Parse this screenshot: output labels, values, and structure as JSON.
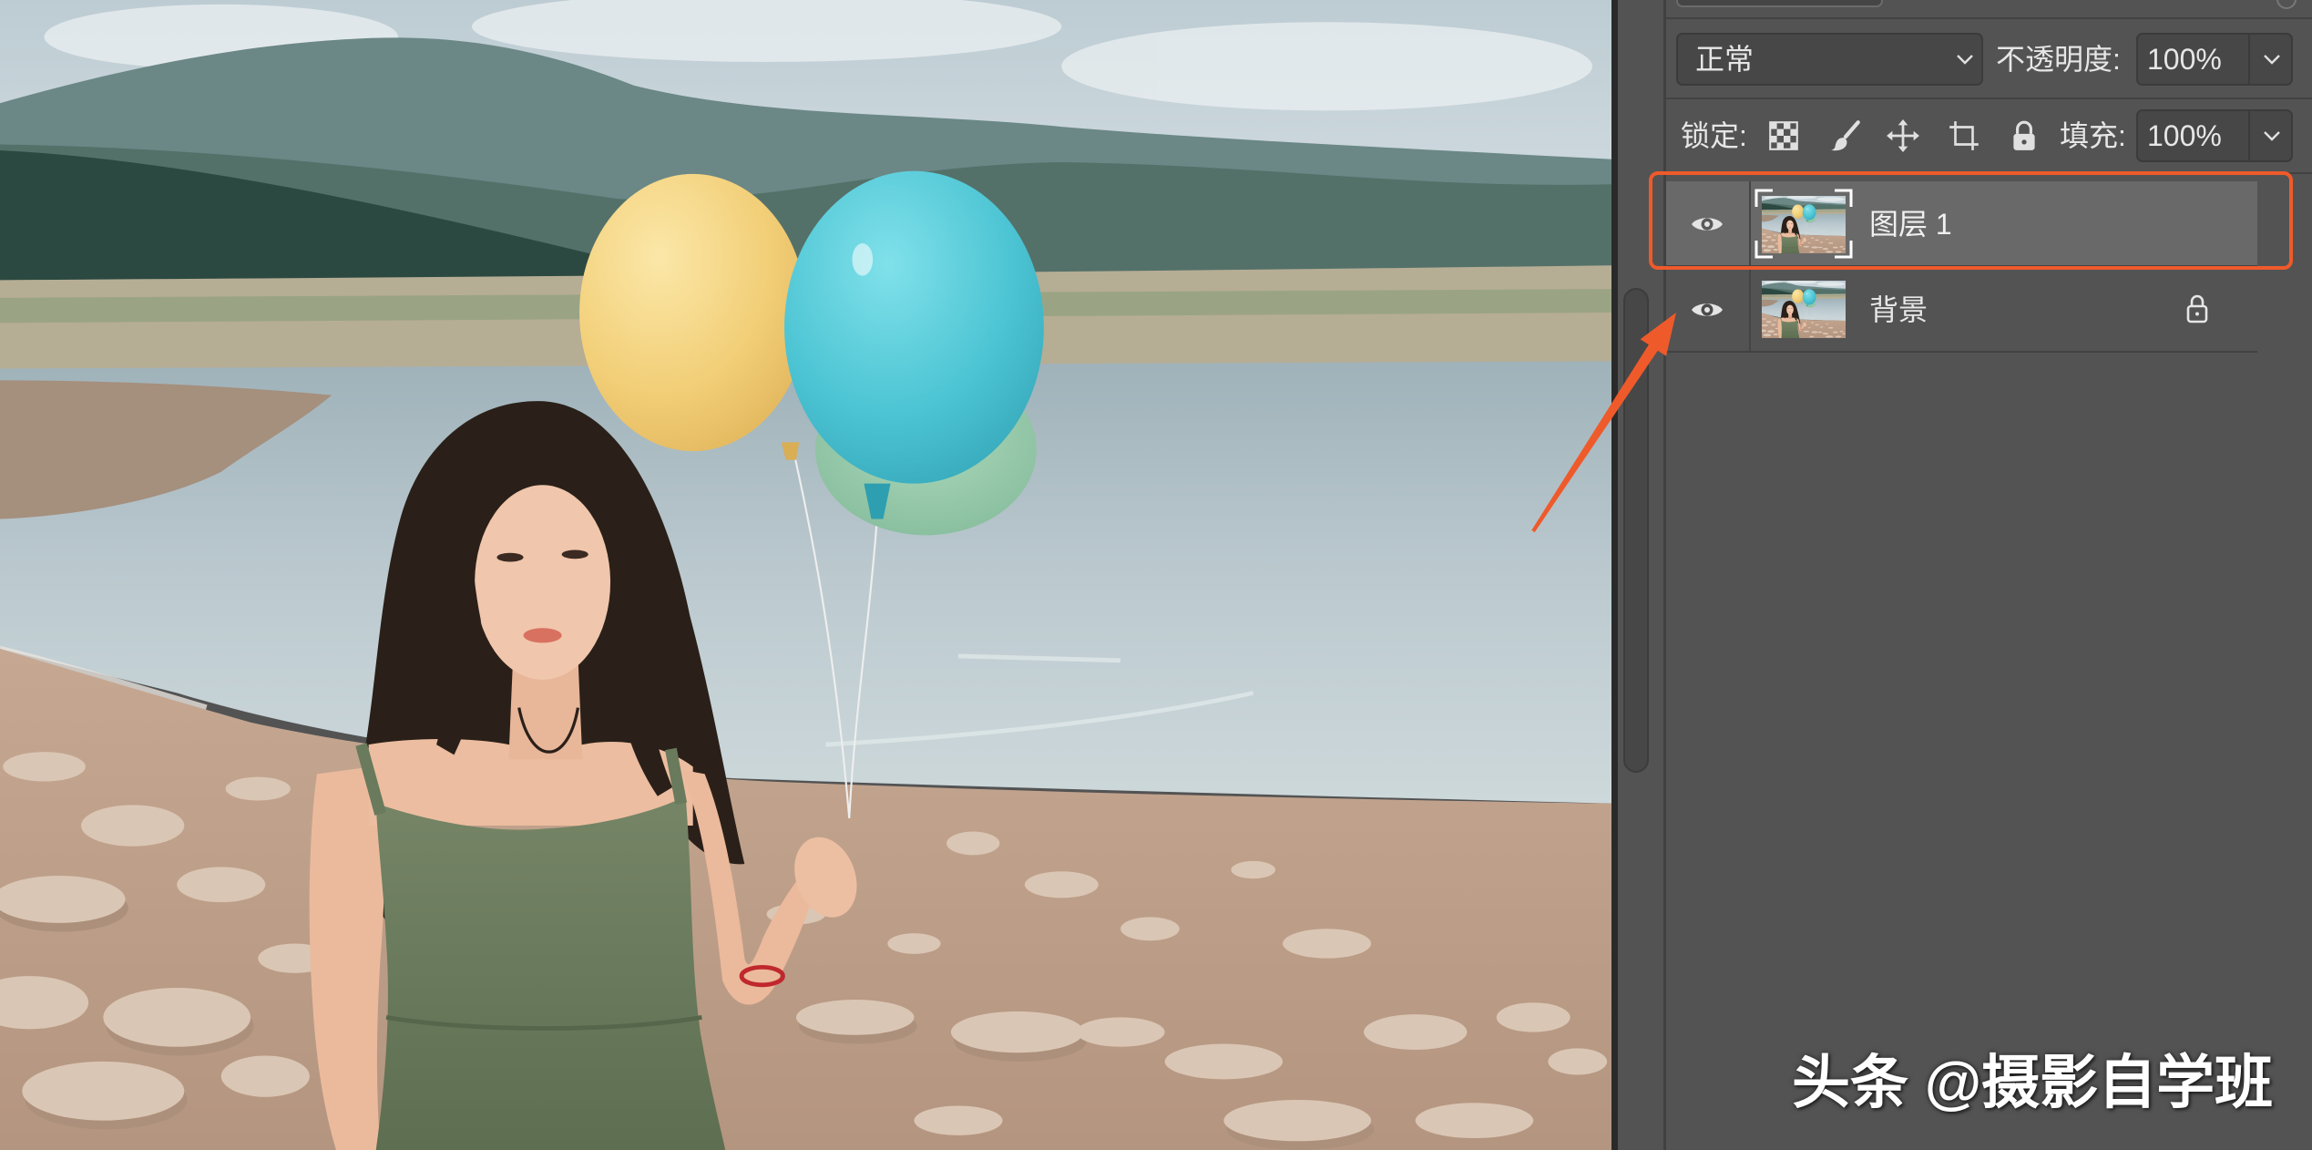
{
  "theme": {
    "panel_bg": "#535353",
    "selected_row_bg": "#696969",
    "field_bg": "#474747",
    "text_color": "#e6e6e6",
    "annotation_color": "#ef5a2b"
  },
  "layers_panel": {
    "blend_mode": "正常",
    "opacity_label": "不透明度:",
    "opacity_value": "100%",
    "lock_label": "锁定:",
    "lock_buttons": [
      {
        "icon": "lock-transparent-pixels-icon"
      },
      {
        "icon": "lock-image-pixels-icon"
      },
      {
        "icon": "lock-position-icon"
      },
      {
        "icon": "lock-artboard-icon"
      },
      {
        "icon": "lock-all-icon"
      }
    ],
    "fill_label": "填充:",
    "fill_value": "100%",
    "layers": [
      {
        "name": "图层 1",
        "visible": true,
        "selected": true,
        "locked": false,
        "visibility_icon": "eye-icon"
      },
      {
        "name": "背景",
        "visible": true,
        "selected": false,
        "locked": true,
        "visibility_icon": "eye-icon",
        "lock_icon": "lock-icon"
      }
    ]
  },
  "watermark": {
    "text": "头条 @摄影自学班"
  }
}
